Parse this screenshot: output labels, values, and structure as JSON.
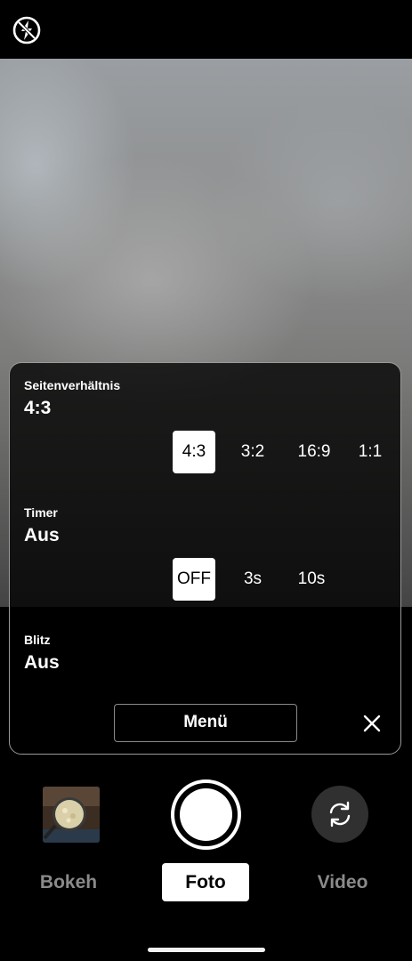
{
  "top_bar": {
    "flash_icon": "flash-off-icon"
  },
  "settings_panel": {
    "aspect_ratio": {
      "label": "Seitenverhältnis",
      "value": "4:3",
      "options": [
        "4:3",
        "3:2",
        "16:9",
        "1:1"
      ],
      "selected": "4:3"
    },
    "timer": {
      "label": "Timer",
      "value": "Aus",
      "options": [
        "OFF",
        "3s",
        "10s"
      ],
      "selected": "OFF"
    },
    "flash": {
      "label": "Blitz",
      "value": "Aus"
    },
    "menu_button": "Menü",
    "close_icon": "close-icon"
  },
  "controls": {
    "gallery_icon": "gallery-thumbnail",
    "switch_icon": "switch-camera-icon"
  },
  "modes": {
    "items": [
      "Bokeh",
      "Foto",
      "Video"
    ],
    "active": "Foto"
  }
}
